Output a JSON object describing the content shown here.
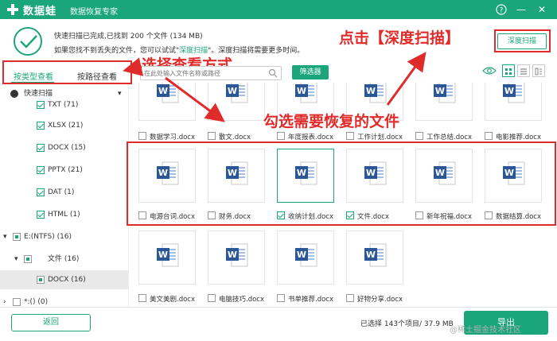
{
  "titlebar": {
    "brand": "数据蛙",
    "subtitle": "数据恢复专家",
    "help": "?",
    "minimize": "—",
    "close": "✕"
  },
  "status": {
    "line1": "快速扫描已完成,已找到 200 个文件 (134 MB)",
    "line2_prefix": "如果您找不到丢失的文件，您可以试试\"",
    "line2_link": "深度扫描",
    "line2_suffix": "\"。深度扫描将需要更多时间。"
  },
  "deep_scan_button": "深度扫描",
  "annotations": {
    "deep": "点击【深度扫描】",
    "view": "选择查看方式",
    "select": "勾选需要恢复的文件"
  },
  "tabs": {
    "by_type": "按类型查看",
    "by_path": "按路径查看"
  },
  "tree": {
    "quick_scan": "快速扫描",
    "items": [
      {
        "label": "TXT (71)"
      },
      {
        "label": "XLSX (21)"
      },
      {
        "label": "DOCX (15)"
      },
      {
        "label": "PPTX (21)"
      },
      {
        "label": "DAT (1)"
      },
      {
        "label": "HTML (1)"
      }
    ],
    "drive": "E:(NTFS) (16)",
    "folder": "文件 (16)",
    "docx": "DOCX (16)",
    "other": "*:() (0)"
  },
  "search": {
    "placeholder": "在此处输入文件名称或路径"
  },
  "filter_button": "筛选器",
  "files": {
    "row1": [
      "数据学习.docx",
      "散文.docx",
      "年度报表.docx",
      "工作计划.docx",
      "工作总结.docx",
      "电影推荐.docx"
    ],
    "row2": [
      "电源台词.docx",
      "财务.docx",
      "收纳计划.docx",
      "文件.docx",
      "新年祝福.docx",
      "数据结算.docx"
    ],
    "row3": [
      "美文美剧.docx",
      "电脑技巧.docx",
      "书单推荐.docx",
      "好物分享.docx"
    ]
  },
  "footer": {
    "back": "返回",
    "selected": "已选择 143个项目/ 37.9 MB",
    "export": "导出",
    "watermark": "@稀土掘金技术社区"
  },
  "colors": {
    "accent": "#1aa67a",
    "annotation": "#e02b2b"
  }
}
